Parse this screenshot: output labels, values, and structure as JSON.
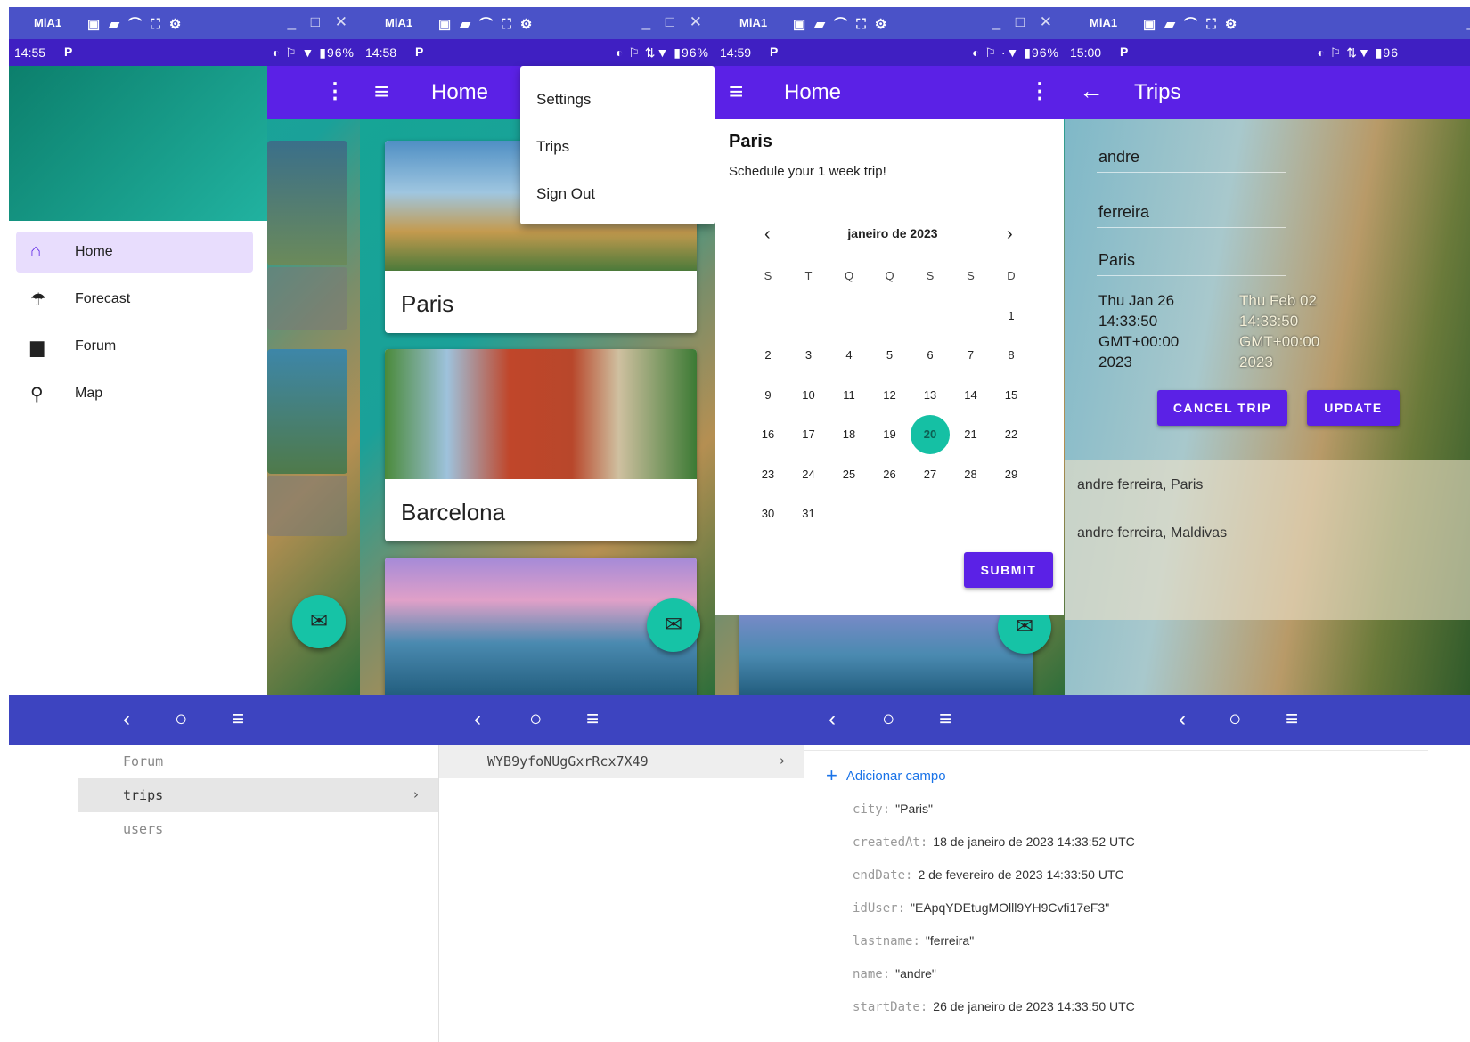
{
  "window": {
    "emulator_label": "MiA1",
    "toolbar_glyphs": "▣ ▰ ⌒ ⛶ ⚙",
    "controls": "_ □ ✕"
  },
  "statusbars": [
    {
      "time": "14:55",
      "p": "P",
      "right": "◐ ⚐ ▼ ▮96%"
    },
    {
      "time": "14:58",
      "p": "P",
      "right": "◐ ⚐ ⇅▼ ▮96%"
    },
    {
      "time": "14:59",
      "p": "P",
      "right": "◐ ⚐ ·▼ ▮96%"
    },
    {
      "time": "15:00",
      "p": "P",
      "right": "◐ ⚐ ⇅▼ ▮96"
    }
  ],
  "nav_glyphs": {
    "back": "‹",
    "home": "○",
    "recents": "≡"
  },
  "drawer": {
    "items": [
      {
        "label": "Home",
        "icon": "home-icon",
        "glyph": "⌂",
        "active": true
      },
      {
        "label": "Forecast",
        "icon": "forecast-icon",
        "glyph": "☂",
        "active": false
      },
      {
        "label": "Forum",
        "icon": "forum-icon",
        "glyph": "▆",
        "active": false
      },
      {
        "label": "Map",
        "icon": "map-pin-icon",
        "glyph": "⚲",
        "active": false
      }
    ]
  },
  "home": {
    "title": "Home",
    "menu": [
      "Settings",
      "Trips",
      "Sign Out"
    ],
    "cards": [
      "Paris",
      "Barcelona"
    ]
  },
  "schedule": {
    "app_title": "Home",
    "title": "Paris",
    "subtitle": "Schedule your 1 week trip!",
    "month": "janeiro de 2023",
    "weekdays": [
      "S",
      "T",
      "Q",
      "Q",
      "S",
      "S",
      "D"
    ],
    "first_weekday_index": 6,
    "days_in_month": 31,
    "selected_day": 20,
    "submit": "SUBMIT"
  },
  "trips": {
    "title": "Trips",
    "first_name": "andre",
    "last_name": "ferreira",
    "city": "Paris",
    "start_date_lines": [
      "Thu Jan 26",
      "14:33:50",
      "GMT+00:00",
      "2023"
    ],
    "end_date_lines": [
      "Thu Feb 02",
      "14:33:50",
      "GMT+00:00",
      "2023"
    ],
    "cancel_button": "CANCEL TRIP",
    "update_button": "UPDATE",
    "list": [
      "andre ferreira, Paris",
      "andre ferreira, Maldivas"
    ]
  },
  "firestore": {
    "collections": [
      {
        "name": "Forum",
        "active": false
      },
      {
        "name": "trips",
        "active": true
      },
      {
        "name": "users",
        "active": false
      }
    ],
    "document_id": "WYB9yfoNUgGxrRcx7X49",
    "add_field": "Adicionar campo",
    "fields": [
      {
        "key": "city",
        "value": "\"Paris\""
      },
      {
        "key": "createdAt",
        "value": "18 de janeiro de 2023 14:33:52 UTC"
      },
      {
        "key": "endDate",
        "value": "2 de fevereiro de 2023 14:33:50 UTC"
      },
      {
        "key": "idUser",
        "value": "\"EApqYDEtugMOlll9YH9Cvfi17eF3\""
      },
      {
        "key": "lastname",
        "value": "\"ferreira\""
      },
      {
        "key": "name",
        "value": "\"andre\""
      },
      {
        "key": "startDate",
        "value": "26 de janeiro de 2023 14:33:50 UTC"
      }
    ]
  },
  "colors": {
    "primary": "#5b21e6",
    "status": "#3f1fc2",
    "nav": "#3d44c0",
    "accent": "#16c3a6"
  }
}
